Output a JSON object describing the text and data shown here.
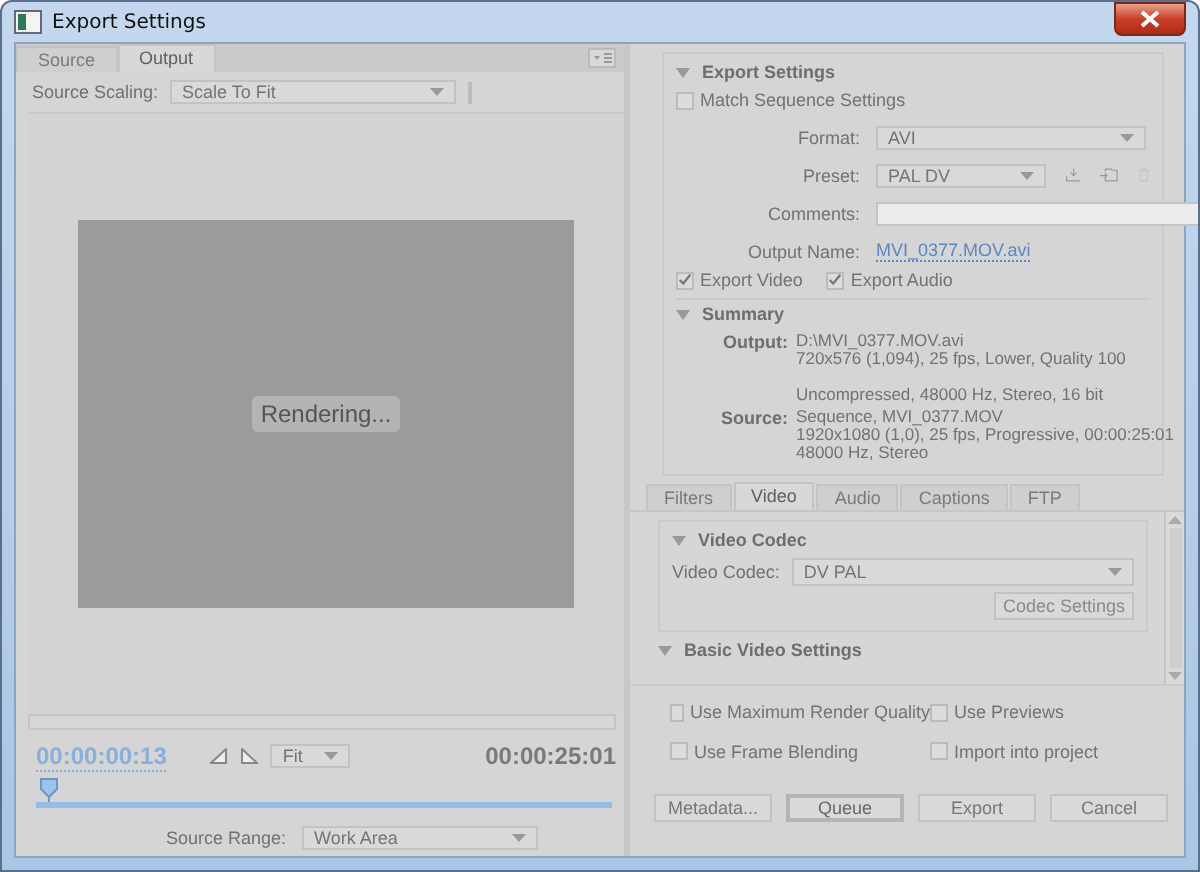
{
  "window": {
    "title": "Export Settings"
  },
  "left_tabs": [
    {
      "label": "Source",
      "selected": false
    },
    {
      "label": "Output",
      "selected": true
    }
  ],
  "source_scaling": {
    "label": "Source Scaling:",
    "value": "Scale To Fit"
  },
  "preview": {
    "status": "Rendering..."
  },
  "timeline": {
    "current_time": "00:00:00:13",
    "zoom": "Fit",
    "duration": "00:00:25:01",
    "level": 0.02
  },
  "source_range": {
    "label": "Source Range:",
    "value": "Work Area"
  },
  "export_settings": {
    "heading": "Export Settings",
    "expanded": true,
    "match_sequence": {
      "label": "Match Sequence Settings",
      "checked": false
    },
    "fields": [
      {
        "label": "Format:",
        "kind": "select",
        "value": "AVI"
      },
      {
        "label": "Preset:",
        "kind": "preset",
        "value": "PAL DV"
      },
      {
        "label": "Comments:",
        "kind": "input"
      },
      {
        "label": "Output Name:",
        "kind": "link",
        "value": "MVI_0377.MOV.avi"
      }
    ],
    "exports": [
      {
        "label": "Export Video",
        "checked": true
      },
      {
        "label": "Export Audio",
        "checked": true
      }
    ]
  },
  "summary": {
    "heading": "Summary",
    "expanded": true,
    "sections": [
      {
        "label": "Output:",
        "groups": [
          [
            "D:\\MVI_0377.MOV.avi",
            "720x576 (1,094), 25 fps, Lower, Quality 100"
          ],
          [
            "Uncompressed, 48000 Hz, Stereo, 16 bit"
          ]
        ]
      },
      {
        "label": "Source:",
        "groups": [
          [
            "Sequence, MVI_0377.MOV",
            "1920x1080 (1,0), 25 fps, Progressive, 00:00:25:01",
            "48000 Hz, Stereo"
          ]
        ]
      }
    ]
  },
  "right_tabs": [
    {
      "label": "Filters",
      "selected": false
    },
    {
      "label": "Video",
      "selected": true
    },
    {
      "label": "Audio",
      "selected": false
    },
    {
      "label": "Captions",
      "selected": false
    },
    {
      "label": "FTP",
      "selected": false
    }
  ],
  "video_codec": {
    "heading": "Video Codec",
    "expanded": true,
    "label": "Video Codec:",
    "value": "DV PAL",
    "button": "Codec Settings"
  },
  "basic_video_settings": {
    "heading": "Basic Video Settings",
    "expanded": true
  },
  "options": [
    {
      "label": "Use Maximum Render Quality",
      "checked": false
    },
    {
      "label": "Use Previews",
      "checked": false
    },
    {
      "label": "Use Frame Blending",
      "checked": false
    },
    {
      "label": "Import into project",
      "checked": false
    }
  ],
  "buttons": [
    {
      "label": "Metadata...",
      "default": false
    },
    {
      "label": "Queue",
      "default": true
    },
    {
      "label": "Export",
      "default": false
    },
    {
      "label": "Cancel",
      "default": false
    }
  ]
}
